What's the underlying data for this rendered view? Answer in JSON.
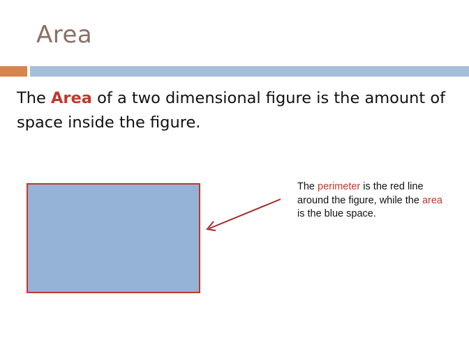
{
  "slide": {
    "title": "Area"
  },
  "definition": {
    "prefix": "The ",
    "term": "Area",
    "suffix": " of a two dimensional figure is the amount of space inside the figure."
  },
  "callout": {
    "part1": "The ",
    "perimeter_word": "perimeter",
    "part2": " is the red line around the figure, while the  ",
    "area_word": "area",
    "part3": " is the blue space."
  },
  "colors": {
    "title_text": "#8a6f66",
    "accent_orange": "#d9844f",
    "accent_blue": "#a5bfd9",
    "highlight_red": "#c0392b",
    "rect_fill": "#95b3d7",
    "rect_stroke": "#c0392b",
    "arrow": "#a52a2a"
  },
  "icons": {
    "arrow": "arrow-pointing-left-icon"
  }
}
